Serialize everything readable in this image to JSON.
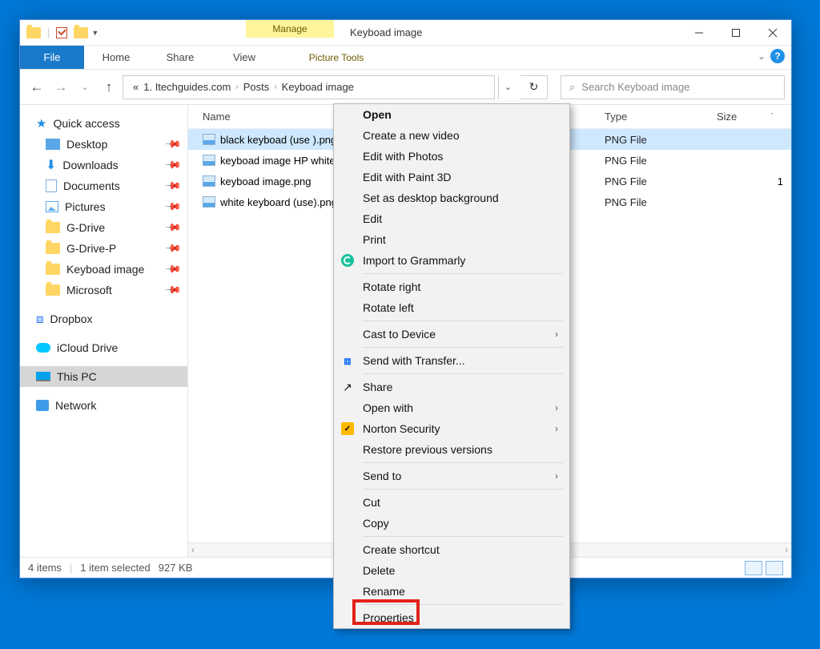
{
  "title": "Keyboad image",
  "manage_label": "Manage",
  "picture_tools_label": "Picture Tools",
  "tabs": {
    "file": "File",
    "home": "Home",
    "share": "Share",
    "view": "View"
  },
  "breadcrumb": {
    "prefix": "«",
    "seg1": "1. Itechguides.com",
    "seg2": "Posts",
    "seg3": "Keyboad image"
  },
  "search_placeholder": "Search Keyboad image",
  "columns": {
    "name": "Name",
    "type": "Type",
    "size": "Size"
  },
  "sidebar": {
    "quick_access": "Quick access",
    "desktop": "Desktop",
    "downloads": "Downloads",
    "documents": "Documents",
    "pictures": "Pictures",
    "gdrive": "G-Drive",
    "gdrivep": "G-Drive-P",
    "keyboad": "Keyboad image",
    "microsoft": "Microsoft",
    "dropbox": "Dropbox",
    "icloud": "iCloud Drive",
    "thispc": "This PC",
    "network": "Network"
  },
  "files": [
    {
      "name": "black keyboad (use ).png",
      "type": "PNG File",
      "size": ""
    },
    {
      "name": "keyboad image HP white.png",
      "type": "PNG File",
      "size": ""
    },
    {
      "name": "keyboad image.png",
      "type": "PNG File",
      "size": "1"
    },
    {
      "name": "white keyboard (use).png",
      "type": "PNG File",
      "size": ""
    }
  ],
  "status": {
    "items": "4 items",
    "selected": "1 item selected",
    "size": "927 KB"
  },
  "ctx": {
    "open": "Open",
    "create_video": "Create a new video",
    "edit_photos": "Edit with Photos",
    "edit_paint3d": "Edit with Paint 3D",
    "set_bg": "Set as desktop background",
    "edit": "Edit",
    "print": "Print",
    "grammarly": "Import to Grammarly",
    "rotate_r": "Rotate right",
    "rotate_l": "Rotate left",
    "cast": "Cast to Device",
    "transfer": "Send with Transfer...",
    "share": "Share",
    "open_with": "Open with",
    "norton": "Norton Security",
    "restore": "Restore previous versions",
    "send_to": "Send to",
    "cut": "Cut",
    "copy": "Copy",
    "shortcut": "Create shortcut",
    "delete": "Delete",
    "rename": "Rename",
    "properties": "Properties"
  }
}
